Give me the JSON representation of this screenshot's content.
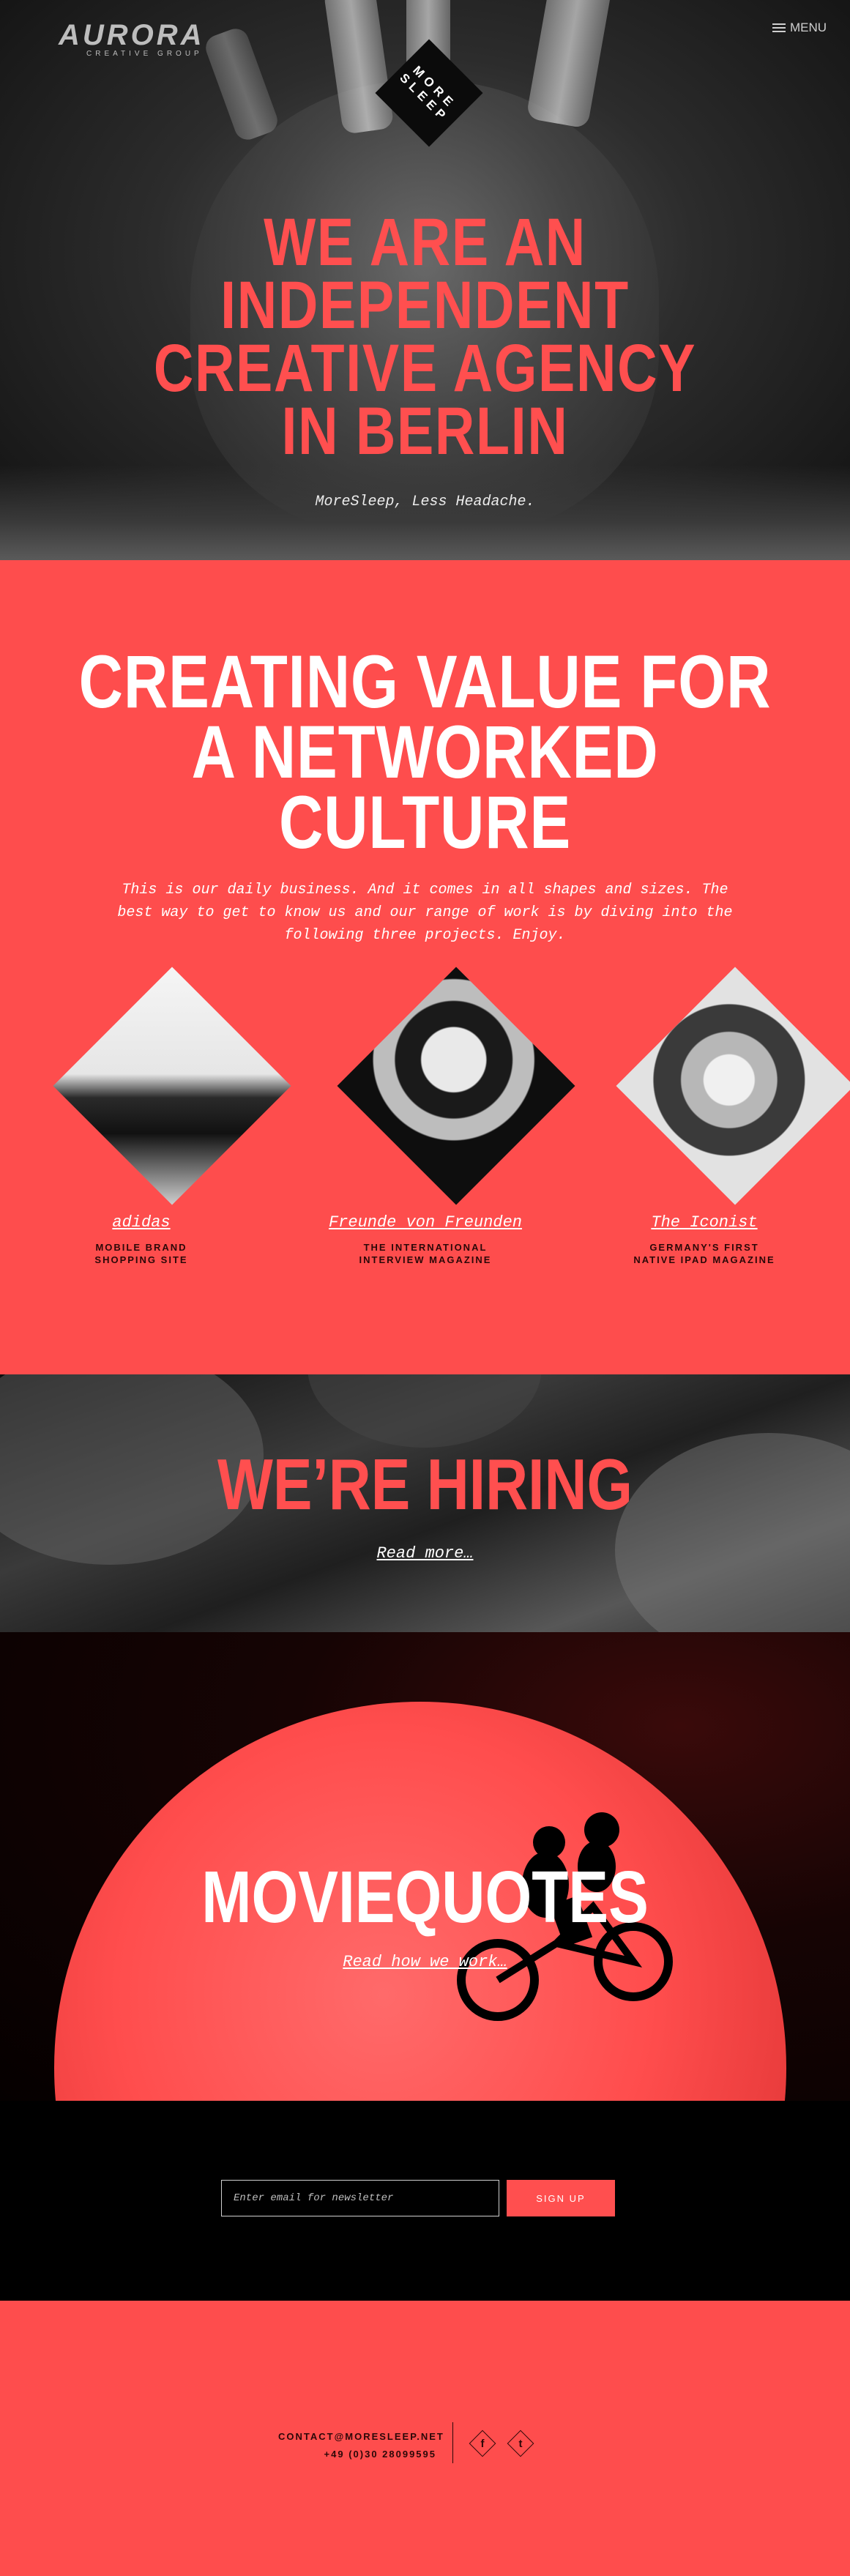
{
  "header": {
    "logo_word": "AURORA",
    "logo_sub": "CREATIVE GROUP",
    "menu_label": "MENU",
    "badge": "MORE SLEEP"
  },
  "hero": {
    "title_lines": [
      "WE ARE AN",
      "INDEPENDENT",
      "CREATIVE AGENCY",
      "IN BERLIN"
    ],
    "tagline": "MoreSleep, Less Headache."
  },
  "services": {
    "title_lines": [
      "CREATING VALUE FOR",
      "A NETWORKED",
      "CULTURE"
    ],
    "body": "This is our daily business. And it comes in all shapes and sizes. The best way to get to know us and our range of work is by diving into the following three projects. Enjoy.",
    "projects": [
      {
        "name": "adidas",
        "desc_lines": [
          "MOBILE BRAND",
          "SHOPPING SITE"
        ]
      },
      {
        "name": "Freunde von Freunden",
        "desc_lines": [
          "THE INTERNATIONAL",
          "INTERVIEW MAGAZINE"
        ]
      },
      {
        "name": "The Iconist",
        "desc_lines": [
          "GERMANY'S FIRST",
          "NATIVE IPAD MAGAZINE"
        ]
      }
    ]
  },
  "hiring": {
    "title": "WE’RE HIRING",
    "link": "Read more…"
  },
  "movie": {
    "title": "MOVIEQUOTES",
    "link": "Read how we work…"
  },
  "newsletter": {
    "placeholder": "Enter email for newsletter",
    "button": "SIGN UP"
  },
  "footer": {
    "email": "CONTACT@MORESLEEP.NET",
    "phone": "+49 (0)30 28099595",
    "social": [
      {
        "icon": "facebook-icon",
        "glyph": "f"
      },
      {
        "icon": "twitter-icon",
        "glyph": "t"
      }
    ]
  },
  "colors": {
    "accent": "#fe4d4d",
    "dark": "#000000",
    "white": "#ffffff"
  }
}
